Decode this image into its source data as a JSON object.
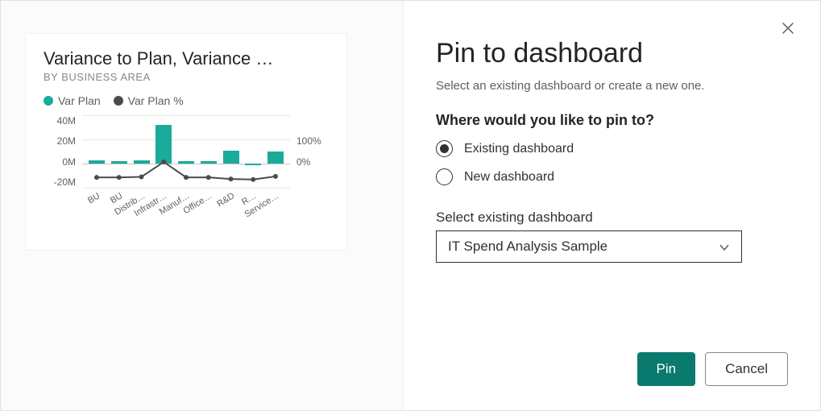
{
  "dialog": {
    "title": "Pin to dashboard",
    "subtitle": "Select an existing dashboard or create a new one.",
    "question": "Where would you like to pin to?",
    "radio_existing": "Existing dashboard",
    "radio_new": "New dashboard",
    "select_label": "Select existing dashboard",
    "select_value": "IT Spend Analysis Sample",
    "pin_button": "Pin",
    "cancel_button": "Cancel"
  },
  "tile": {
    "title": "Variance to Plan, Variance …",
    "subtitle": "BY BUSINESS AREA",
    "legend_var_plan": "Var Plan",
    "legend_var_plan_pct": "Var Plan %"
  },
  "chart_data": {
    "type": "bar+line",
    "categories": [
      "BU",
      "BU",
      "Distrib…",
      "Infrastr…",
      "Manuf…",
      "Office…",
      "R&D",
      "R…",
      "Service…"
    ],
    "series": [
      {
        "name": "Var Plan",
        "axis": "left",
        "type": "bar",
        "values": [
          3,
          2,
          3,
          32,
          2,
          2,
          11,
          -1,
          10
        ]
      },
      {
        "name": "Var Plan %",
        "axis": "right",
        "type": "line",
        "values": [
          0,
          0,
          1,
          30,
          0,
          0,
          -3,
          -4,
          2
        ]
      }
    ],
    "y_left": {
      "ticks": [
        -20,
        0,
        20,
        40
      ],
      "format": "M",
      "tick_labels": [
        "-20M",
        "0M",
        "20M",
        "40M"
      ]
    },
    "y_right": {
      "ticks": [
        0,
        100
      ],
      "format": "%",
      "tick_labels": [
        "0%",
        "100%"
      ]
    },
    "y_left_range": [
      -20,
      40
    ],
    "y_right_range": [
      -20,
      120
    ]
  }
}
